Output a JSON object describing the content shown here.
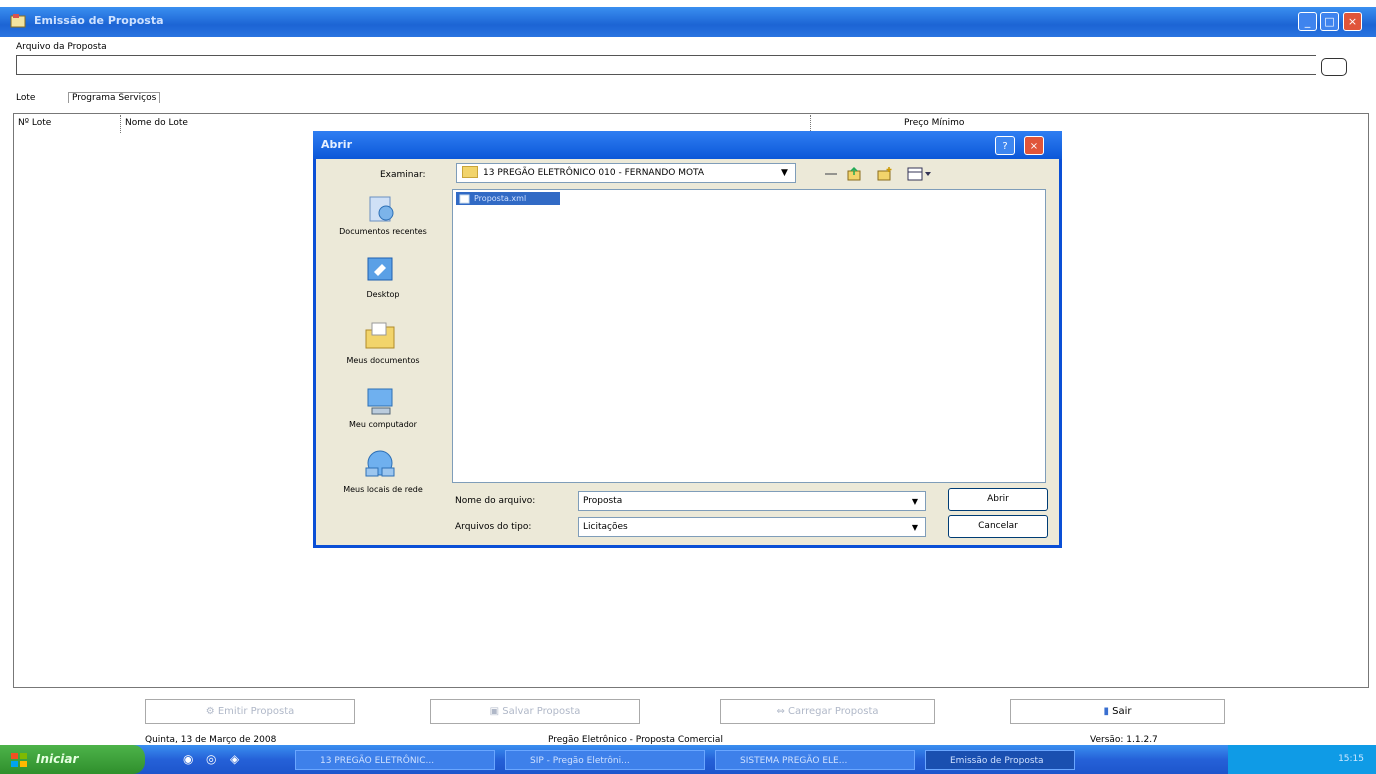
{
  "window": {
    "title": "Emissão de Proposta"
  },
  "file_section": {
    "label": "Arquivo da Proposta",
    "value": ""
  },
  "tabs": [
    "Lote",
    "Programa Serviços"
  ],
  "grid": {
    "columns": [
      "Nº Lote",
      "Nome do Lote",
      "Preço Mínimo"
    ]
  },
  "bottom_buttons": {
    "b1": "Emitir Proposta",
    "b2": "Salvar Proposta",
    "b3": "Carregar Proposta",
    "exit": "Sair"
  },
  "status": {
    "date": "Quinta, 13 de Março de 2008",
    "message": "Pregão Eletrônico - Proposta Comercial",
    "version": "Versão: 1.1.2.7"
  },
  "dialog": {
    "title": "Abrir",
    "lookin_label": "Examinar:",
    "lookin_value": "13 PREGÃO ELETRÔNICO 010 - FERNANDO MOTA",
    "places": [
      "Documentos recentes",
      "Desktop",
      "Meus documentos",
      "Meu computador",
      "Meus locais de rede"
    ],
    "file_item": "Proposta.xml",
    "name_label": "Nome do arquivo:",
    "name_value": "Proposta",
    "type_label": "Arquivos do tipo:",
    "type_value": "Licitações",
    "open_label": "Abrir",
    "cancel_label": "Cancelar",
    "help": "?",
    "close": "×"
  },
  "taskbar": {
    "start": "Iniciar",
    "tasks": [
      "13 PREGÃO ELETRÔNIC...",
      "SIP - Pregão Eletrôni...",
      "SISTEMA PREGÃO ELE...",
      "Emissão de Proposta"
    ],
    "clock": "15:15"
  },
  "colors": {
    "title_bar": "#1c64d4",
    "dialog_border": "#0a4fd6",
    "selection": "#316ac5",
    "start_button": "#2f8f2c"
  }
}
